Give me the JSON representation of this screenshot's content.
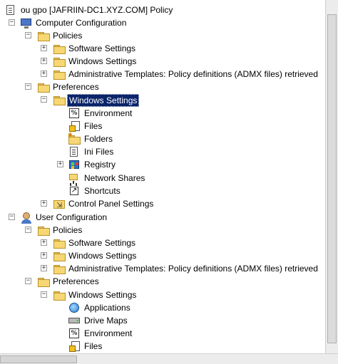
{
  "tree": {
    "root": {
      "label": "ou gpo [JAFRIIN-DC1.XYZ.COM] Policy"
    },
    "computer_configuration": {
      "label": "Computer Configuration",
      "policies": {
        "label": "Policies",
        "items": [
          "Software Settings",
          "Windows Settings",
          "Administrative Templates: Policy definitions (ADMX files) retrieved"
        ]
      },
      "preferences": {
        "label": "Preferences",
        "windows_settings": {
          "label": "Windows Settings",
          "items": [
            "Environment",
            "Files",
            "Folders",
            "Ini Files",
            "Registry",
            "Network Shares",
            "Shortcuts"
          ]
        },
        "control_panel_settings": {
          "label": "Control Panel Settings"
        }
      }
    },
    "user_configuration": {
      "label": "User Configuration",
      "policies": {
        "label": "Policies",
        "items": [
          "Software Settings",
          "Windows Settings",
          "Administrative Templates: Policy definitions (ADMX files) retrieved"
        ]
      },
      "preferences": {
        "label": "Preferences",
        "windows_settings": {
          "label": "Windows Settings",
          "items": [
            "Applications",
            "Drive Maps",
            "Environment",
            "Files"
          ]
        }
      }
    }
  },
  "icons": {
    "expand": "+",
    "collapse": "−",
    "environment": "%"
  },
  "colors": {
    "selection_bg": "#0a246a",
    "folder": "#f7d774"
  }
}
